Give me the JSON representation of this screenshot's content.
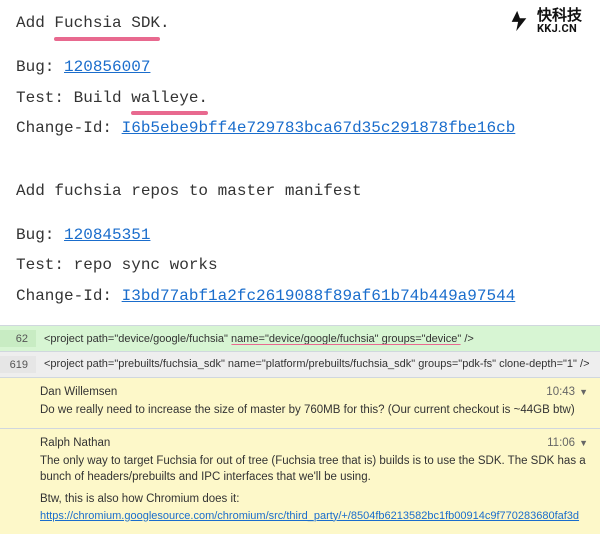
{
  "watermark": {
    "cn": "快科技",
    "url": "KKJ.CN"
  },
  "commits": [
    {
      "title_prefix": "Add ",
      "title_highlight": "Fuchsia SDK",
      "title_suffix": ".",
      "bug_label": "Bug: ",
      "bug_id": "120856007",
      "test_label": "Test: ",
      "test_value_prefix": "Build ",
      "test_value_highlight": "walleye.",
      "change_label": "Change-Id: ",
      "change_id": "I6b5ebe9bff4e729783bca67d35c291878fbe16cb"
    },
    {
      "title_full": "Add fuchsia repos to master manifest",
      "bug_label": "Bug: ",
      "bug_id": "120845351",
      "test_label": "Test: ",
      "test_value": "repo sync works",
      "change_label": "Change-Id: ",
      "change_id": "I3bd77abf1a2fc2619088f89af61b74b449a97544"
    }
  ],
  "diff": {
    "lines": [
      {
        "num": "62",
        "code_prefix": "<project path=\"device/google/fuchsia\" ",
        "code_highlight": "name=\"device/google/fuchsia\" groups=\"device\"",
        "code_suffix": " />"
      },
      {
        "num": "619",
        "code": "<project path=\"prebuilts/fuchsia_sdk\" name=\"platform/prebuilts/fuchsia_sdk\" groups=\"pdk-fs\" clone-depth=\"1\" />"
      }
    ],
    "comments": [
      {
        "author": "Dan Willemsen",
        "time": "10:43",
        "body_p1": "Do we really need to increase the size of master by 760MB for this? (Our current checkout is ~44GB btw)"
      },
      {
        "author": "Ralph Nathan",
        "time": "11:06",
        "body_p1": "The only way to target Fuchsia for out of tree (Fuchsia tree that is) builds is to use the SDK. The SDK has a bunch of headers/prebuilts and IPC interfaces that we'll be using.",
        "body_p2": "Btw, this is also how Chromium does it:",
        "link": "https://chromium.googlesource.com/chromium/src/third_party/+/8504fb6213582bc1fb00914c9f770283680faf3d"
      }
    ]
  }
}
